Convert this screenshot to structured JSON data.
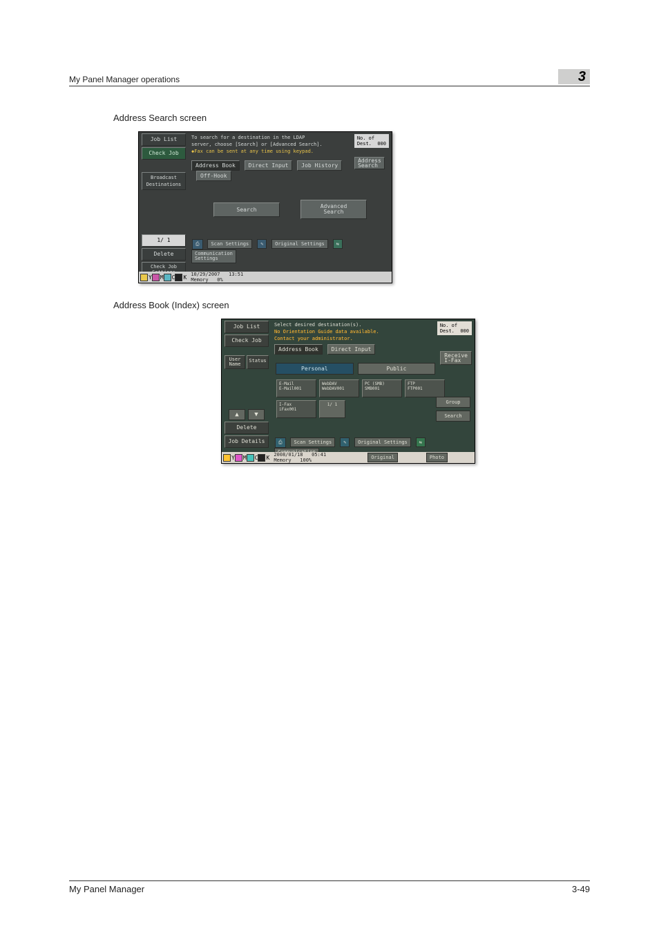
{
  "header": {
    "title": "My Panel Manager operations",
    "chapter": "3"
  },
  "section1": {
    "label": "Address Search screen"
  },
  "panel1": {
    "left": {
      "job_list": "Job List",
      "check_job": "Check Job",
      "broadcast": "Broadcast\nDestinations",
      "page": "1/  1",
      "delete": "Delete",
      "check_job_settings": "Check Job\nSettings"
    },
    "msg1": "To search for a destination in the LDAP\nserver, choose [Search] or [Advanced Search].",
    "msg2": "Fax can be sent at any time using keypad.",
    "count_label": "No. of\nDest.",
    "count_value": "000",
    "tabs": {
      "address_book": "Address Book",
      "direct_input": "Direct Input",
      "job_history": "Job History",
      "address_search": "Address\nSearch",
      "off_hook": "Off-Hook"
    },
    "mid": {
      "search": "Search",
      "advanced": "Advanced\nSearch"
    },
    "bottom": {
      "scan_settings": "Scan Settings",
      "original_settings": "Original Settings",
      "comm_settings": "Communication\nSettings",
      "date": "10/29/2007",
      "time": "13:51",
      "mem_label": "Memory",
      "mem_value": "0%"
    }
  },
  "section2": {
    "label": "Address Book (Index) screen"
  },
  "panel2": {
    "left": {
      "job_list": "Job List",
      "check_job": "Check Job",
      "user_name": "User\nName",
      "status": "Status",
      "delete": "Delete",
      "job_details": "Job Details"
    },
    "msg1": "Select desired destination(s).",
    "msg2": "No Orientation Guide data available.\nContact your administrator.",
    "count_label": "No. of\nDest.",
    "count_value": "000",
    "tabs": {
      "address_book": "Address Book",
      "direct_input": "Direct Input"
    },
    "subtabs": {
      "personal": "Personal",
      "public": "Public",
      "receive_ifax": "Receive\nI-Fax"
    },
    "chips": {
      "email": "E-Mail\nE-Mail001",
      "webdav": "WebDAV\nWebDAV001",
      "smb": "PC (SMB)\nSMB001",
      "ftp": "FTP\nFTP001",
      "ifax": "I-Fax\niFax001"
    },
    "chip_page": "1/ 1",
    "rbtns": {
      "group": "Group",
      "search": "Search"
    },
    "bottom": {
      "scan_settings": "Scan Settings",
      "original_settings": "Original Settings",
      "comm_settings": "Communication\nSettings",
      "date": "2008/01/18",
      "time": "05:41",
      "mem_label": "Memory",
      "mem_value": "100%",
      "original": "Original",
      "photo": "Photo"
    }
  },
  "footer": {
    "left": "My Panel Manager",
    "right": "3-49"
  }
}
